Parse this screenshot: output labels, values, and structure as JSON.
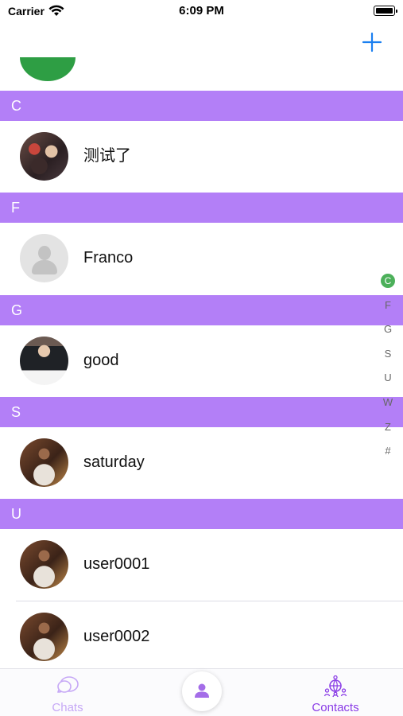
{
  "status_bar": {
    "carrier": "Carrier",
    "time": "6:09 PM"
  },
  "nav": {
    "add_icon": "plus-icon"
  },
  "colors": {
    "accent": "#8a3ce6",
    "section_header": "#b37ff7",
    "index_active": "#4cb05a",
    "add_button": "#1a7ff0"
  },
  "sections": [
    {
      "letter": "C",
      "contacts": [
        {
          "name": "测试了",
          "avatar": "group-photo"
        }
      ]
    },
    {
      "letter": "F",
      "contacts": [
        {
          "name": "Franco",
          "avatar": "default-person"
        }
      ]
    },
    {
      "letter": "G",
      "contacts": [
        {
          "name": "good",
          "avatar": "suit-photo"
        }
      ]
    },
    {
      "letter": "S",
      "contacts": [
        {
          "name": "saturday",
          "avatar": "player-photo"
        }
      ]
    },
    {
      "letter": "U",
      "contacts": [
        {
          "name": "user0001",
          "avatar": "player-photo"
        },
        {
          "name": "user0002",
          "avatar": "player-photo"
        }
      ]
    }
  ],
  "index_bar": {
    "letters": [
      "C",
      "F",
      "G",
      "S",
      "U",
      "W",
      "Z",
      "#"
    ],
    "active": "C"
  },
  "tab_bar": {
    "tabs": [
      {
        "label": "Chats",
        "icon": "chat-bubbles-icon",
        "selected": false
      },
      {
        "label": "Contacts",
        "icon": "contacts-globe-icon",
        "selected": true
      }
    ],
    "center_icon": "person-icon"
  }
}
